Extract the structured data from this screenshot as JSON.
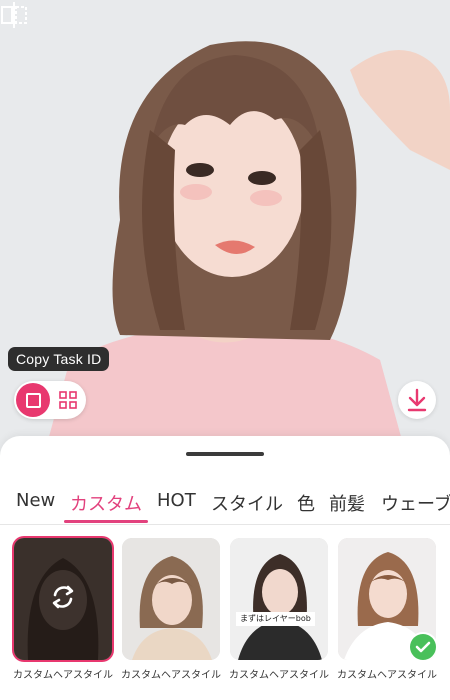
{
  "hero": {
    "photo": "woman-bob-haircut-portrait"
  },
  "overlay": {
    "copy_task_label": "Copy Task ID",
    "compare_icon": "compare-split-icon",
    "download_icon": "download-icon"
  },
  "tabs": [
    {
      "label": "New"
    },
    {
      "label": "カスタム",
      "active": true
    },
    {
      "label": "HOT"
    },
    {
      "label": "スタイル"
    },
    {
      "label": "色"
    },
    {
      "label": "前髪"
    },
    {
      "label": "ウェーブ"
    }
  ],
  "cards": [
    {
      "label": "カスタムヘアスタイル",
      "selected": true,
      "icon": "swap-icon"
    },
    {
      "label": "カスタムヘアスタイル"
    },
    {
      "label": "カスタムヘアスタイル",
      "caption": "まずはレイヤーbob"
    },
    {
      "label": "カスタムヘアスタイル",
      "checked": true
    }
  ],
  "colors": {
    "accent": "#e2417d",
    "check": "#49c05a"
  }
}
